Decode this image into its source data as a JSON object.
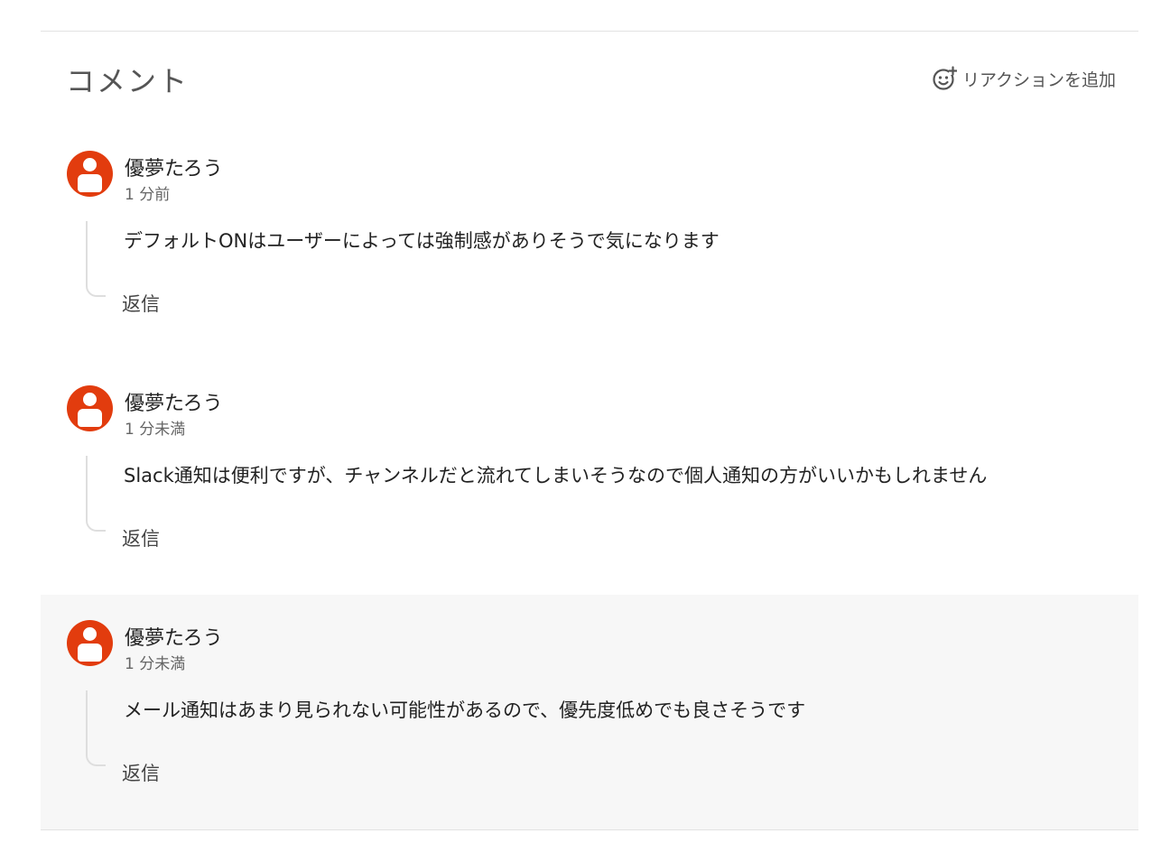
{
  "header": {
    "title": "コメント",
    "reaction_label": "リアクションを追加"
  },
  "comments": [
    {
      "author": "優夢たろう",
      "time": "1 分前",
      "text": "デフォルトONはユーザーによっては強制感がありそうで気になります",
      "reply_label": "返信",
      "highlighted": false
    },
    {
      "author": "優夢たろう",
      "time": "1 分未満",
      "text": "Slack通知は便利ですが、チャンネルだと流れてしまいそうなので個人通知の方がいいかもしれません",
      "reply_label": "返信",
      "highlighted": false
    },
    {
      "author": "優夢たろう",
      "time": "1 分未満",
      "text": "メール通知はあまり見られない可能性があるので、優先度低めでも良さそうです",
      "reply_label": "返信",
      "highlighted": true
    }
  ],
  "colors": {
    "avatar": "#e23c0e",
    "highlight_bg": "#f7f7f7",
    "thread_line": "#dedede"
  },
  "icons": {
    "reaction": "add-reaction-icon",
    "avatar": "user-avatar-icon"
  }
}
